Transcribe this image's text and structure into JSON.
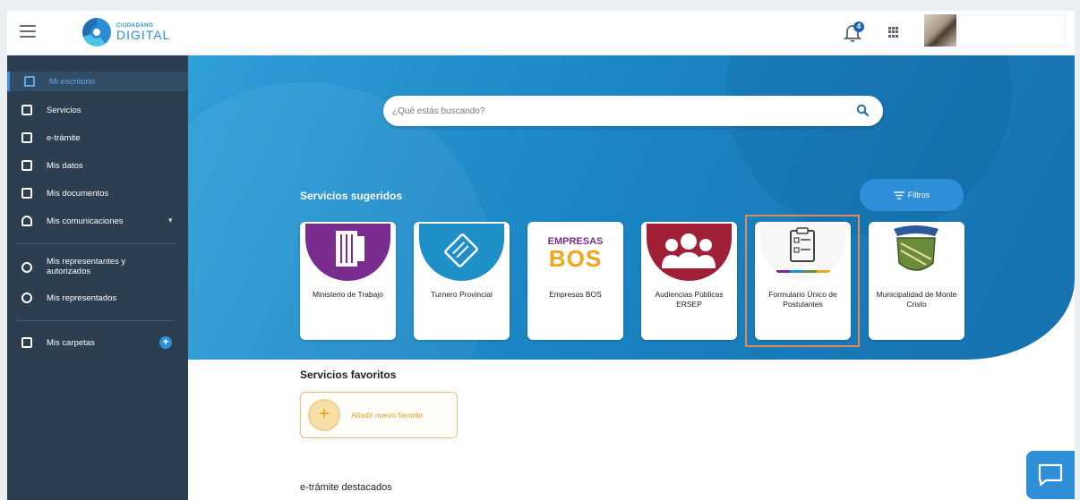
{
  "header": {
    "logo_small": "CIUDADANO",
    "logo_big": "DIGITAL",
    "notifications_count": "4"
  },
  "sidebar": {
    "items": [
      {
        "label": "Mi escritorio",
        "icon": "home-icon"
      },
      {
        "label": "Servicios",
        "icon": "services-icon"
      },
      {
        "label": "e-trámite",
        "icon": "folder-icon"
      },
      {
        "label": "Mis datos",
        "icon": "id-card-icon"
      },
      {
        "label": "Mis documentos",
        "icon": "documents-icon"
      },
      {
        "label": "Mis comunicaciones",
        "icon": "bell-icon"
      },
      {
        "label": "Mis representantes y autorizados",
        "icon": "people-icon"
      },
      {
        "label": "Mis representados",
        "icon": "person-share-icon"
      },
      {
        "label": "Mis carpetas",
        "icon": "folder-icon"
      }
    ]
  },
  "search": {
    "placeholder": "¿Qué estás buscando?"
  },
  "suggested": {
    "title": "Servicios sugeridos",
    "filters_label": "Filtros",
    "cards": [
      {
        "name": "Ministerio de Trabajo",
        "color": "#7b2c8f"
      },
      {
        "name": "Turnero Provincial",
        "color": "#1f8fc8"
      },
      {
        "name": "Empresas BOS",
        "color": "#f4a31c"
      },
      {
        "name": "Audiencias Públicas ERSEP",
        "color": "#a01e36"
      },
      {
        "name": "Formulario Único de Postulantes",
        "color": "#ffffff"
      },
      {
        "name": "Municipalidad de Monte Cristo",
        "color": "#6b8c3a"
      }
    ],
    "bos_top": "EMPRESAS",
    "bos_bottom": "BOS"
  },
  "favorites": {
    "title": "Servicios favoritos",
    "add_label": "Añadir nuevo favorito"
  },
  "etramite": {
    "title": "e-trámite destacados"
  },
  "colors": {
    "sidebar_bg": "#2c3e50",
    "hero_blue": "#1b86c4",
    "accent": "#2e8ed8",
    "favorite_orange": "#e89b1e"
  }
}
